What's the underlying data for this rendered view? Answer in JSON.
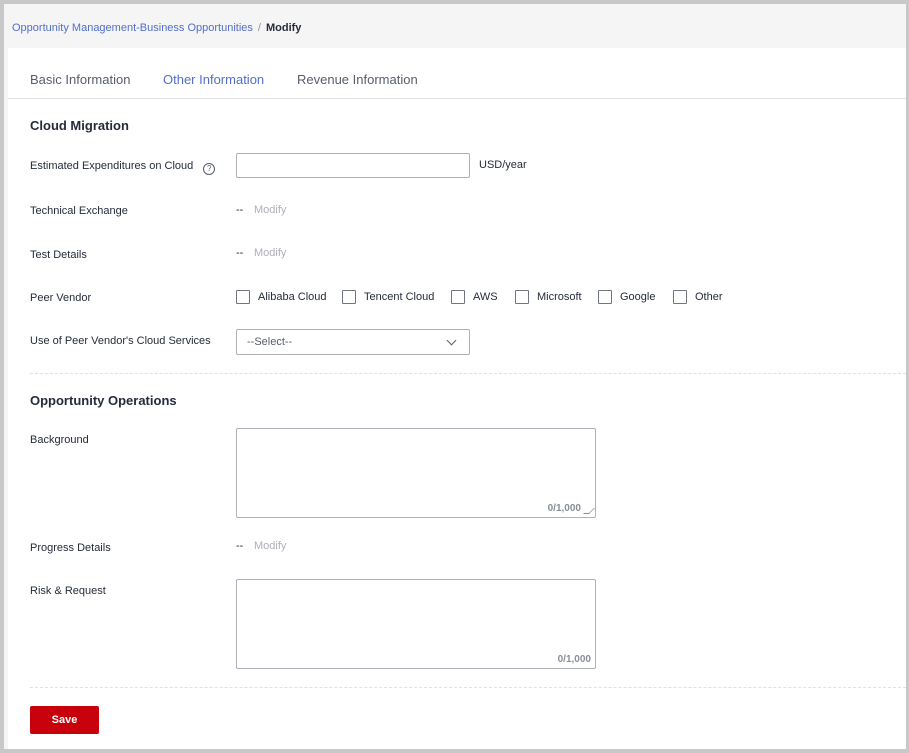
{
  "breadcrumb": {
    "parent": "Opportunity Management-Business Opportunities",
    "separator": "/",
    "current": "Modify"
  },
  "tabs": [
    {
      "label": "Basic Information",
      "active": false
    },
    {
      "label": "Other Information",
      "active": true
    },
    {
      "label": "Revenue Information",
      "active": false
    }
  ],
  "cloud_migration": {
    "title": "Cloud Migration",
    "estimated_expenditures": {
      "label": "Estimated Expenditures on Cloud",
      "help_icon": "question-circle-icon",
      "value": "",
      "unit": "USD/year"
    },
    "technical_exchange": {
      "label": "Technical Exchange",
      "value": "--",
      "action": "Modify"
    },
    "test_details": {
      "label": "Test Details",
      "value": "--",
      "action": "Modify"
    },
    "peer_vendor": {
      "label": "Peer Vendor",
      "options": [
        {
          "label": "Alibaba Cloud",
          "checked": false
        },
        {
          "label": "Tencent Cloud",
          "checked": false
        },
        {
          "label": "AWS",
          "checked": false
        },
        {
          "label": "Microsoft",
          "checked": false
        },
        {
          "label": "Google",
          "checked": false
        },
        {
          "label": "Other",
          "checked": false
        }
      ]
    },
    "peer_services": {
      "label": "Use of Peer Vendor's Cloud Services",
      "selected": "--Select--"
    }
  },
  "opportunity_operations": {
    "title": "Opportunity Operations",
    "background": {
      "label": "Background",
      "value": "",
      "counter": "0/1,000"
    },
    "progress_details": {
      "label": "Progress Details",
      "value": "--",
      "action": "Modify"
    },
    "risk_request": {
      "label": "Risk & Request",
      "value": "",
      "counter": "0/1,000"
    }
  },
  "actions": {
    "save_label": "Save"
  },
  "colors": {
    "accent": "#526ecc",
    "primary_button": "#c7000b",
    "muted_link": "#adb0b8"
  }
}
